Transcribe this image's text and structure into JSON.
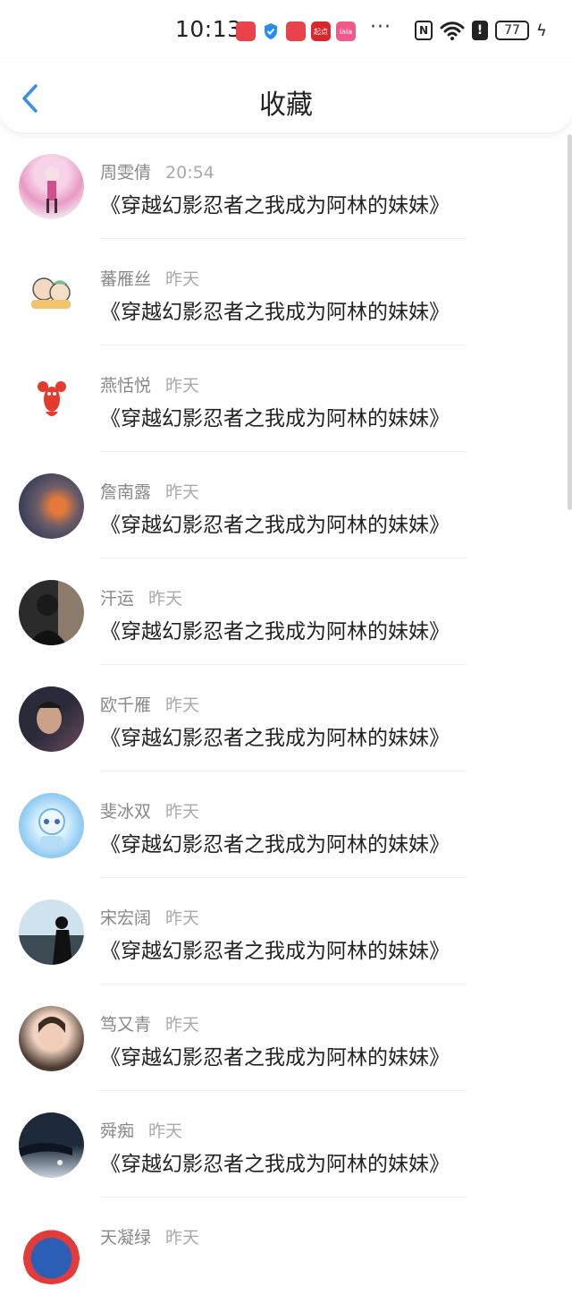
{
  "status_bar": {
    "time": "10:13",
    "app_icons": [
      {
        "name": "huawei-mall-icon",
        "label": "",
        "color": "#e8424a"
      },
      {
        "name": "shield-app-icon",
        "label": "",
        "color": "#2a8cf0"
      },
      {
        "name": "huawei-mall-icon-2",
        "label": "",
        "color": "#e8424a"
      },
      {
        "name": "qidian-app-icon",
        "label": "起点",
        "color": "#d9282d"
      },
      {
        "name": "lala-app-icon",
        "label": "lala",
        "color": "#ef5a8a"
      }
    ],
    "more": "···",
    "battery": "77"
  },
  "header": {
    "title": "收藏",
    "accent_color": "#3a8ee6"
  },
  "items": [
    {
      "name": "周雯倩",
      "time": "20:54",
      "title": "《穿越幻影忍者之我成为阿林的妹妹》"
    },
    {
      "name": "蕃雁丝",
      "time": "昨天",
      "title": "《穿越幻影忍者之我成为阿林的妹妹》"
    },
    {
      "name": "燕恬悦",
      "time": "昨天",
      "title": "《穿越幻影忍者之我成为阿林的妹妹》"
    },
    {
      "name": "詹南露",
      "time": "昨天",
      "title": "《穿越幻影忍者之我成为阿林的妹妹》"
    },
    {
      "name": "汗运",
      "time": "昨天",
      "title": "《穿越幻影忍者之我成为阿林的妹妹》"
    },
    {
      "name": "欧千雁",
      "time": "昨天",
      "title": "《穿越幻影忍者之我成为阿林的妹妹》"
    },
    {
      "name": "斐冰双",
      "time": "昨天",
      "title": "《穿越幻影忍者之我成为阿林的妹妹》"
    },
    {
      "name": "宋宏阔",
      "time": "昨天",
      "title": "《穿越幻影忍者之我成为阿林的妹妹》"
    },
    {
      "name": "笃又青",
      "time": "昨天",
      "title": "《穿越幻影忍者之我成为阿林的妹妹》"
    },
    {
      "name": "舜痴",
      "time": "昨天",
      "title": "《穿越幻影忍者之我成为阿林的妹妹》"
    },
    {
      "name": "天凝绿",
      "time": "昨天",
      "title": ""
    }
  ]
}
